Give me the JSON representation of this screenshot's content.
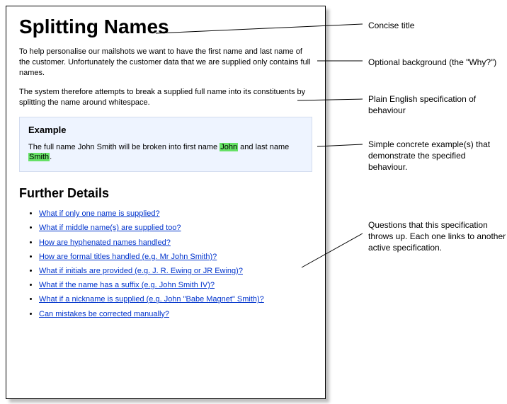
{
  "title": "Splitting Names",
  "background_para": "To help personalise our mailshots we want to have the first name and last name of the customer. Unfortunately the customer data that we are supplied only contains full names.",
  "spec_para": "The system therefore attempts to break a supplied full name into its constituents by splitting the name around whitespace.",
  "example": {
    "heading": "Example",
    "prefix": "The full name John Smith will be broken into first name ",
    "first_hl": "John",
    "mid": " and last name ",
    "last_hl": "Smith",
    "suffix": "."
  },
  "further_details": {
    "heading": "Further Details",
    "links": [
      "What if only one name is supplied?",
      "What if middle name(s) are supplied too?",
      "How are hyphenated names handled?",
      "How are formal titles handled (e.g. Mr John Smith)?",
      "What if initials are provided (e.g. J. R. Ewing or JR Ewing)?",
      "What if the name has a suffix (e.g. John Smith IV)?",
      "What if a nickname is supplied (e.g. John \"Babe Magnet\" Smith)?",
      "Can mistakes be corrected manually?"
    ]
  },
  "annotations": {
    "a1": "Concise title",
    "a2": "Optional background (the \"Why?\")",
    "a3": "Plain English specification of behaviour",
    "a4": "Simple concrete example(s) that demonstrate the specified behaviour.",
    "a5": "Questions that this specification throws up. Each one links to another active specification."
  }
}
